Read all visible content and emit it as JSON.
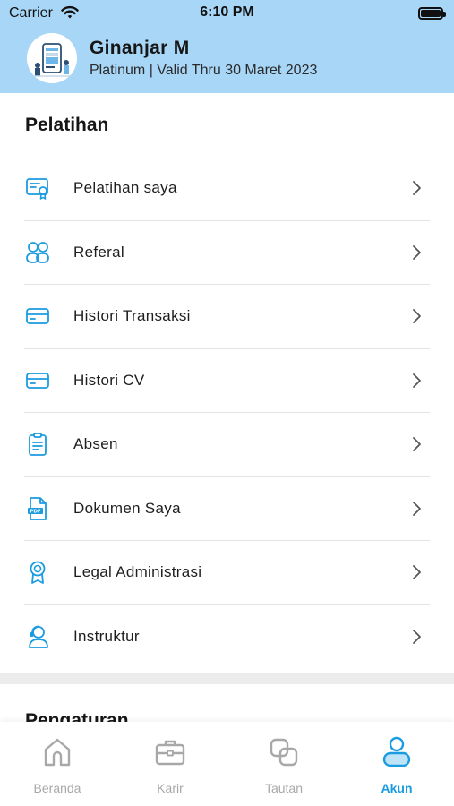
{
  "status_bar": {
    "carrier": "Carrier",
    "time": "6:10 PM"
  },
  "profile": {
    "name": "Ginanjar M",
    "membership": "Platinum | Valid Thru 30 Maret 2023"
  },
  "section_title": "Pelatihan",
  "menu_items": [
    {
      "label": "Pelatihan saya",
      "icon": "certificate-icon"
    },
    {
      "label": "Referal",
      "icon": "users-icon"
    },
    {
      "label": "Histori Transaksi",
      "icon": "card-icon"
    },
    {
      "label": "Histori CV",
      "icon": "card-icon"
    },
    {
      "label": "Absen",
      "icon": "clipboard-icon"
    },
    {
      "label": "Dokumen Saya",
      "icon": "pdf-document-icon"
    },
    {
      "label": "Legal Administrasi",
      "icon": "award-icon"
    },
    {
      "label": "Instruktur",
      "icon": "instructor-icon"
    }
  ],
  "section_title_2": "Pengaturan",
  "tabs": [
    {
      "label": "Beranda",
      "icon": "home-icon",
      "active": false
    },
    {
      "label": "Karir",
      "icon": "briefcase-icon",
      "active": false
    },
    {
      "label": "Tautan",
      "icon": "link-icon",
      "active": false
    },
    {
      "label": "Akun",
      "icon": "account-icon",
      "active": true
    }
  ],
  "colors": {
    "header_bg": "#a8d6f7",
    "accent": "#1b9be0",
    "tab_inactive": "#a8a8a8"
  }
}
